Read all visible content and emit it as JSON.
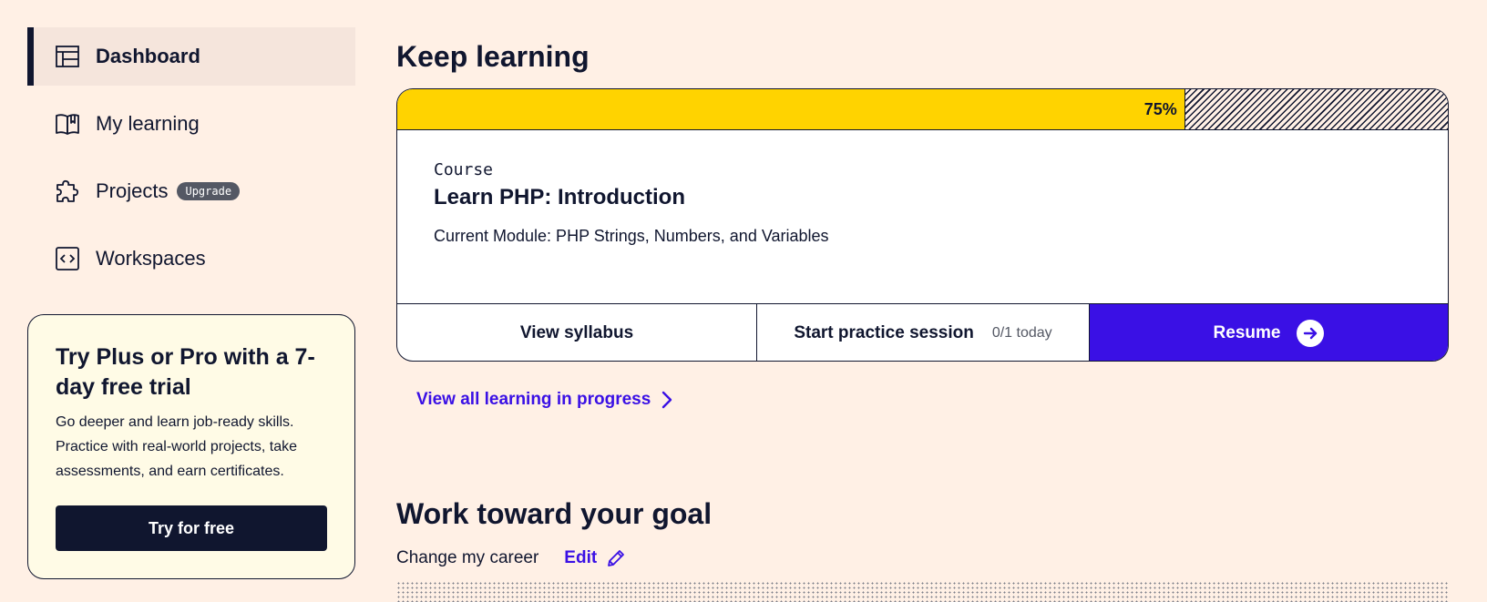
{
  "sidebar": {
    "items": [
      {
        "label": "Dashboard",
        "icon": "dashboard-icon",
        "active": true
      },
      {
        "label": "My learning",
        "icon": "book-icon",
        "active": false
      },
      {
        "label": "Projects",
        "icon": "puzzle-icon",
        "active": false,
        "badge": "Upgrade"
      },
      {
        "label": "Workspaces",
        "icon": "code-icon",
        "active": false
      }
    ]
  },
  "trial": {
    "title": "Try Plus or Pro with a 7-day free trial",
    "text": "Go deeper and learn job-ready skills. Practice with real-world projects, take assessments, and earn certificates.",
    "button_label": "Try for free"
  },
  "keep_learning": {
    "title": "Keep learning",
    "progress": 0.75,
    "progress_label": "75%",
    "course_type": "Course",
    "course_name": "Learn PHP: Introduction",
    "current_module": "Current Module: PHP Strings, Numbers, and Variables",
    "syllabus_label": "View syllabus",
    "practice_label": "Start practice session",
    "practice_count": "0/1 today",
    "resume_label": "Resume",
    "view_all_label": "View all learning in progress"
  },
  "goal": {
    "title": "Work toward your goal",
    "goal_text": "Change my career",
    "edit_label": "Edit"
  },
  "colors": {
    "background": "#fff0e5",
    "navy": "#10162f",
    "accent": "#3a10e5",
    "progress": "#ffd300",
    "trial_bg": "#fffbe6"
  }
}
